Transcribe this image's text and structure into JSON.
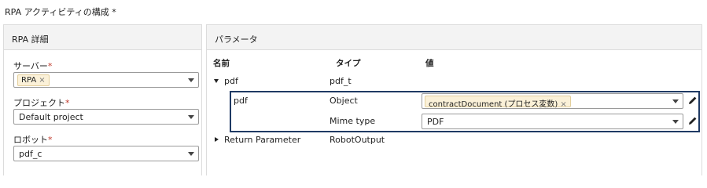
{
  "section": {
    "title": "RPA アクティビティの構成",
    "required_mark": "*"
  },
  "left_panel": {
    "header": "RPA 詳細",
    "server": {
      "label": "サーバー",
      "required_mark": "*",
      "chip": "RPA",
      "chip_remove": "×"
    },
    "project": {
      "label": "プロジェクト",
      "required_mark": "*",
      "value": "Default project"
    },
    "robot": {
      "label": "ロボット",
      "required_mark": "*",
      "value": "pdf_c"
    }
  },
  "right_panel": {
    "header": "パラメータ",
    "columns": {
      "name": "名前",
      "type": "タイプ",
      "value": "値"
    },
    "rows": {
      "pdf_group": {
        "name": "pdf",
        "type": "pdf_t"
      },
      "pdf_object": {
        "name": "pdf",
        "type": "Object",
        "chip": "contractDocument (プロセス変数)",
        "chip_remove": "×"
      },
      "mime": {
        "type": "Mime type",
        "value": "PDF"
      },
      "return_param": {
        "name": "Return Parameter",
        "type": "RobotOutput"
      }
    }
  },
  "icons": {
    "caret": "chevron-down-icon",
    "edit": "pencil-icon",
    "expand": "triangle-icon"
  },
  "colors": {
    "highlight_border": "#1f3a64",
    "chip_bg": "#fbf1d8",
    "required": "#c0392b"
  }
}
